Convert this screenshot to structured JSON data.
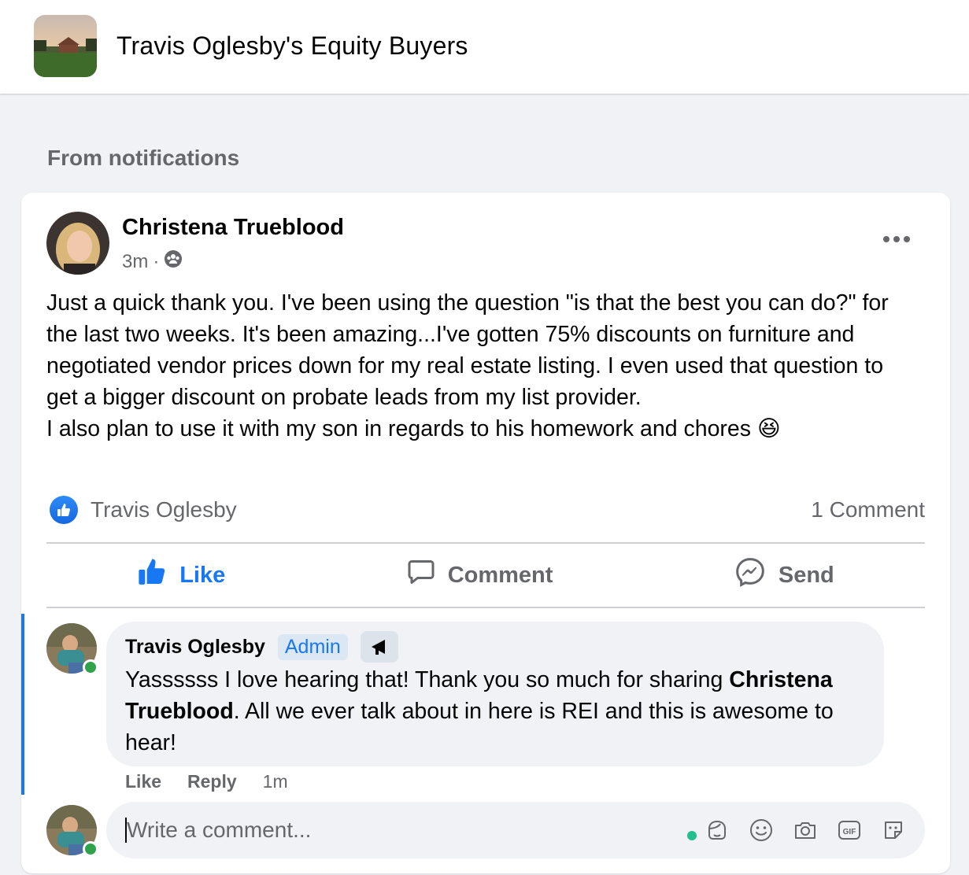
{
  "group": {
    "title": "Travis Oglesby's Equity Buyers",
    "thumbnail_icon": "group-photo-house"
  },
  "section_label": "From notifications",
  "post": {
    "author": "Christena Trueblood",
    "time": "3m",
    "separator": "·",
    "audience_icon": "group-audience-icon",
    "more_icon": "more-options-icon",
    "body_paragraphs": [
      "Just a quick thank you. I've been using the question \"is that the best you can do?\" for the last two weeks. It's been amazing...I've gotten 75% discounts on furniture and negotiated vendor prices down for my real estate listing. I even used that question to get a bigger discount on probate leads from my list provider.",
      "I also plan to use it with my son in regards to his homework and chores 😆"
    ],
    "reactor": "Travis Oglesby",
    "comment_count": "1 Comment",
    "actions": {
      "like": "Like",
      "comment": "Comment",
      "send": "Send"
    }
  },
  "comment": {
    "author": "Travis Oglesby",
    "badge": "Admin",
    "badge_icon": "top-contributor-icon",
    "text_before": "Yassssss I love hearing that! Thank you so much for sharing ",
    "mention": "Christena Trueblood",
    "text_after": ". All we ever talk about in here is REI and this is awesome to hear!",
    "like_label": "Like",
    "reply_label": "Reply",
    "time": "1m"
  },
  "composer": {
    "placeholder": "Write a comment...",
    "icons": [
      "avatar-sticker-icon",
      "emoji-icon",
      "camera-icon",
      "gif-icon",
      "sticker-icon"
    ]
  },
  "colors": {
    "accent": "#1877f2",
    "background": "#f0f2f5",
    "secondary_text": "#65676b",
    "online": "#31a24c"
  }
}
